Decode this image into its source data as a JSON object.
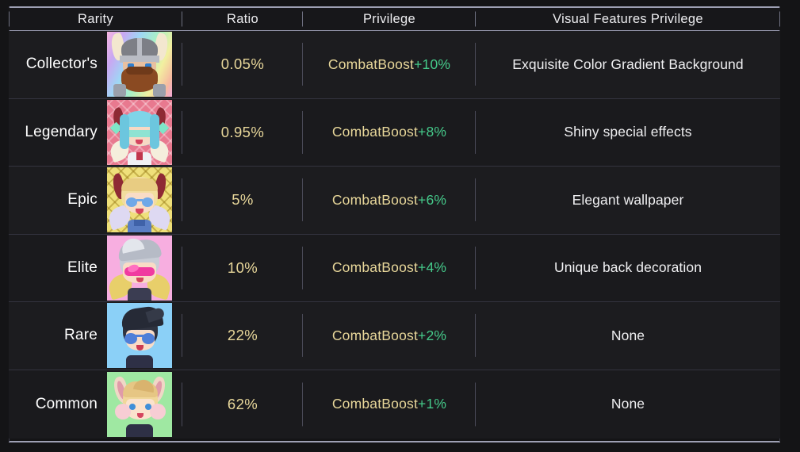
{
  "table": {
    "columns": [
      {
        "key": "rarity",
        "label": "Rarity"
      },
      {
        "key": "ratio",
        "label": "Ratio"
      },
      {
        "key": "priv",
        "label": "Privilege"
      },
      {
        "key": "visual",
        "label": "Visual Features Privilege"
      }
    ],
    "rows": [
      {
        "rarity": "Collector's",
        "ratio": "0.05%",
        "privilege_base": "CombatBoost",
        "privilege_boost": "+10%",
        "visual": "Exquisite Color Gradient Background",
        "avatar": "viking-rainbow-avatar"
      },
      {
        "rarity": "Legendary",
        "ratio": "0.95%",
        "privilege_base": "CombatBoost",
        "privilege_boost": "+8%",
        "visual": "Shiny special effects",
        "avatar": "blue-haired-horned-avatar"
      },
      {
        "rarity": "Epic",
        "ratio": "5%",
        "privilege_base": "CombatBoost",
        "privilege_boost": "+6%",
        "visual": "Elegant wallpaper",
        "avatar": "blonde-horned-angel-avatar"
      },
      {
        "rarity": "Elite",
        "ratio": "10%",
        "privilege_base": "CombatBoost",
        "privilege_boost": "+4%",
        "visual": "Unique back decoration",
        "avatar": "silver-hair-visor-avatar"
      },
      {
        "rarity": "Rare",
        "ratio": "22%",
        "privilege_base": "CombatBoost",
        "privilege_boost": "+2%",
        "visual": "None",
        "avatar": "dark-hair-sunglasses-avatar"
      },
      {
        "rarity": "Common",
        "ratio": "62%",
        "privilege_base": "CombatBoost",
        "privilege_boost": "+1%",
        "visual": "None",
        "avatar": "bunny-ears-blonde-avatar"
      }
    ]
  },
  "colors": {
    "page_background": "#141416",
    "row_background": "#1c1c1f",
    "rule": "#9ea0b4",
    "divider": "#4a4a58",
    "header_text": "#ededf0",
    "ratio_text": "#e8d79a",
    "privilege_text": "#e8d79a",
    "boost_text": "#45c98a",
    "visual_text": "#f0f0f2"
  }
}
